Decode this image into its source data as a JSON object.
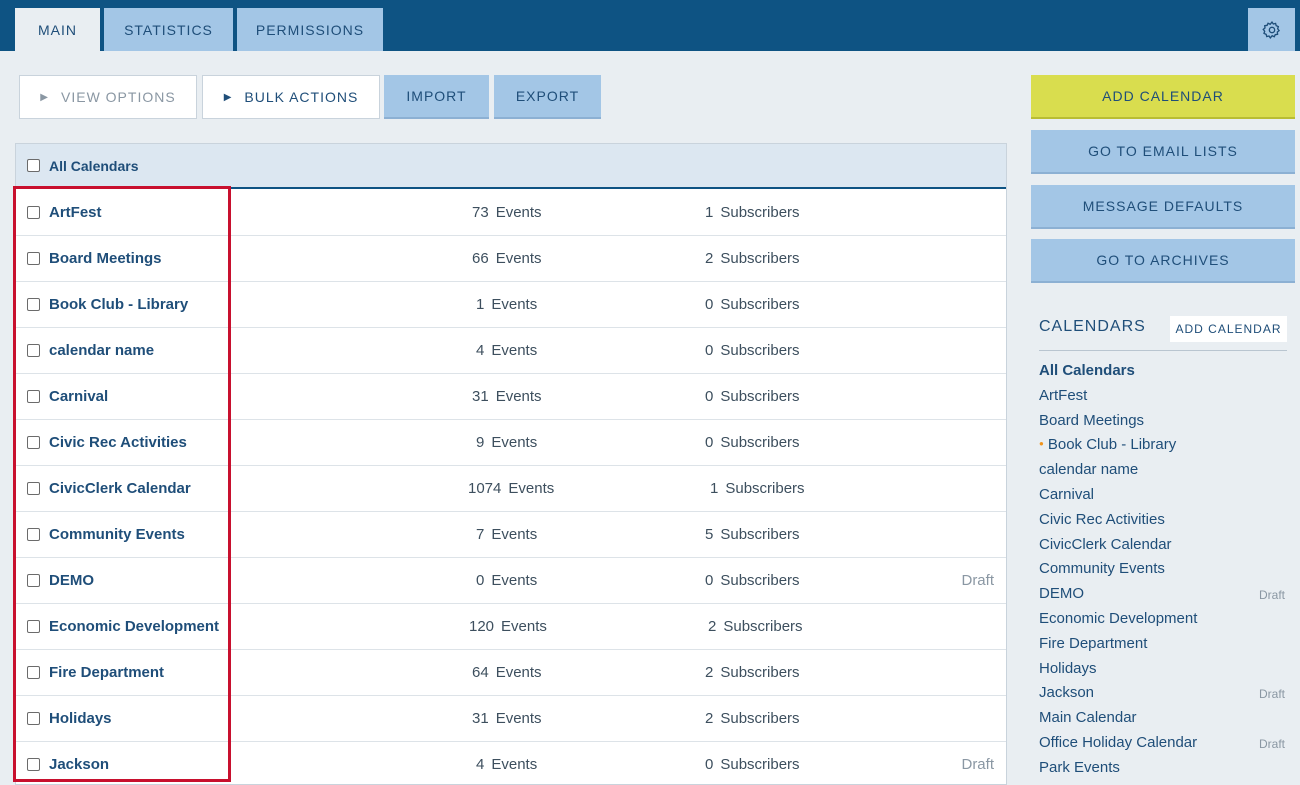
{
  "tabs": [
    {
      "label": "MAIN",
      "active": true
    },
    {
      "label": "STATISTICS",
      "active": false
    },
    {
      "label": "PERMISSIONS",
      "active": false
    }
  ],
  "toolbar": {
    "view_options": "VIEW OPTIONS",
    "bulk_actions": "BULK ACTIONS",
    "import": "IMPORT",
    "export": "EXPORT"
  },
  "table": {
    "header_label": "All Calendars",
    "events_suffix": "Events",
    "subscribers_suffix": "Subscribers",
    "rows": [
      {
        "name": "ArtFest",
        "events": "73",
        "subscribers": "1",
        "status": ""
      },
      {
        "name": "Board Meetings",
        "events": "66",
        "subscribers": "2",
        "status": ""
      },
      {
        "name": "Book Club - Library",
        "events": "1",
        "subscribers": "0",
        "status": ""
      },
      {
        "name": "calendar name",
        "events": "4",
        "subscribers": "0",
        "status": ""
      },
      {
        "name": "Carnival",
        "events": "31",
        "subscribers": "0",
        "status": ""
      },
      {
        "name": "Civic Rec Activities",
        "events": "9",
        "subscribers": "0",
        "status": ""
      },
      {
        "name": "CivicClerk Calendar",
        "events": "1074",
        "subscribers": "1",
        "status": ""
      },
      {
        "name": "Community Events",
        "events": "7",
        "subscribers": "5",
        "status": ""
      },
      {
        "name": "DEMO",
        "events": "0",
        "subscribers": "0",
        "status": "Draft"
      },
      {
        "name": "Economic Development",
        "events": "120",
        "subscribers": "2",
        "status": ""
      },
      {
        "name": "Fire Department",
        "events": "64",
        "subscribers": "2",
        "status": ""
      },
      {
        "name": "Holidays",
        "events": "31",
        "subscribers": "2",
        "status": ""
      },
      {
        "name": "Jackson",
        "events": "4",
        "subscribers": "0",
        "status": "Draft"
      }
    ]
  },
  "actions": {
    "add_calendar": "ADD CALENDAR",
    "email_lists": "GO TO EMAIL LISTS",
    "message_defaults": "MESSAGE DEFAULTS",
    "archives": "GO TO ARCHIVES"
  },
  "sidebar": {
    "title": "CALENDARS",
    "add_button": "ADD CALENDAR",
    "items": [
      {
        "label": "All Calendars",
        "bold": true,
        "dot": false,
        "status": ""
      },
      {
        "label": "ArtFest",
        "bold": false,
        "dot": false,
        "status": ""
      },
      {
        "label": "Board Meetings",
        "bold": false,
        "dot": false,
        "status": ""
      },
      {
        "label": "Book Club - Library",
        "bold": false,
        "dot": true,
        "status": ""
      },
      {
        "label": "calendar name",
        "bold": false,
        "dot": false,
        "status": ""
      },
      {
        "label": "Carnival",
        "bold": false,
        "dot": false,
        "status": ""
      },
      {
        "label": "Civic Rec Activities",
        "bold": false,
        "dot": false,
        "status": ""
      },
      {
        "label": "CivicClerk Calendar",
        "bold": false,
        "dot": false,
        "status": ""
      },
      {
        "label": "Community Events",
        "bold": false,
        "dot": false,
        "status": ""
      },
      {
        "label": "DEMO",
        "bold": false,
        "dot": false,
        "status": "Draft"
      },
      {
        "label": "Economic Development",
        "bold": false,
        "dot": false,
        "status": ""
      },
      {
        "label": "Fire Department",
        "bold": false,
        "dot": false,
        "status": ""
      },
      {
        "label": "Holidays",
        "bold": false,
        "dot": false,
        "status": ""
      },
      {
        "label": "Jackson",
        "bold": false,
        "dot": false,
        "status": "Draft"
      },
      {
        "label": "Main Calendar",
        "bold": false,
        "dot": false,
        "status": ""
      },
      {
        "label": "Office Holiday Calendar",
        "bold": false,
        "dot": false,
        "status": "Draft"
      },
      {
        "label": "Park Events",
        "bold": false,
        "dot": false,
        "status": ""
      }
    ]
  },
  "colors": {
    "topbar": "#0e5383",
    "accent_yellow": "#d9dd4e",
    "button_blue": "#a3c6e6",
    "highlight_red": "#c8102e",
    "status_dot_orange": "#f0941d"
  }
}
